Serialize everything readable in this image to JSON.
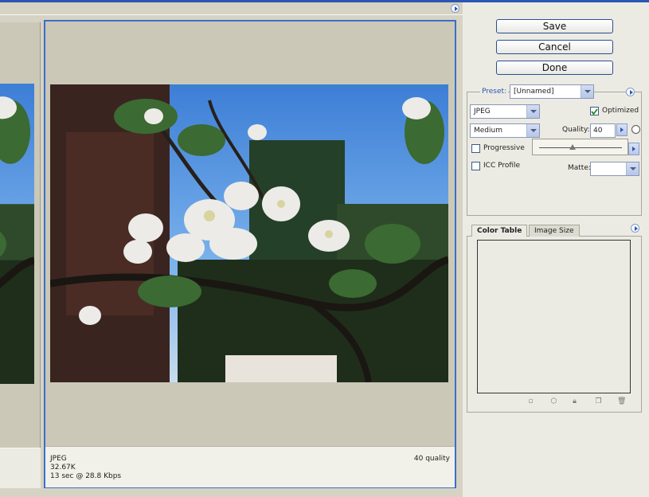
{
  "buttons": {
    "save": "Save",
    "cancel": "Cancel",
    "done": "Done"
  },
  "preset": {
    "label": "Preset:",
    "value": "[Unnamed]"
  },
  "format": {
    "value": "JPEG"
  },
  "quality_level": {
    "value": "Medium"
  },
  "optimized": {
    "label": "Optimized",
    "checked": true
  },
  "quality": {
    "label": "Quality:",
    "value": "40"
  },
  "progressive": {
    "label": "Progressive",
    "checked": false
  },
  "icc_profile": {
    "label": "ICC Profile",
    "checked": false
  },
  "matte": {
    "label": "Matte:",
    "value": ""
  },
  "tabs": {
    "color_table": "Color Table",
    "image_size": "Image Size"
  },
  "preview": {
    "format": "JPEG",
    "size": "32.67K",
    "download": "13 sec @ 28.8 Kbps",
    "quality": "40 quality"
  },
  "colors": {
    "frame_selected": "#3a6fc6",
    "panel_bg": "#ecebe3",
    "accent": "#2b57b3"
  }
}
